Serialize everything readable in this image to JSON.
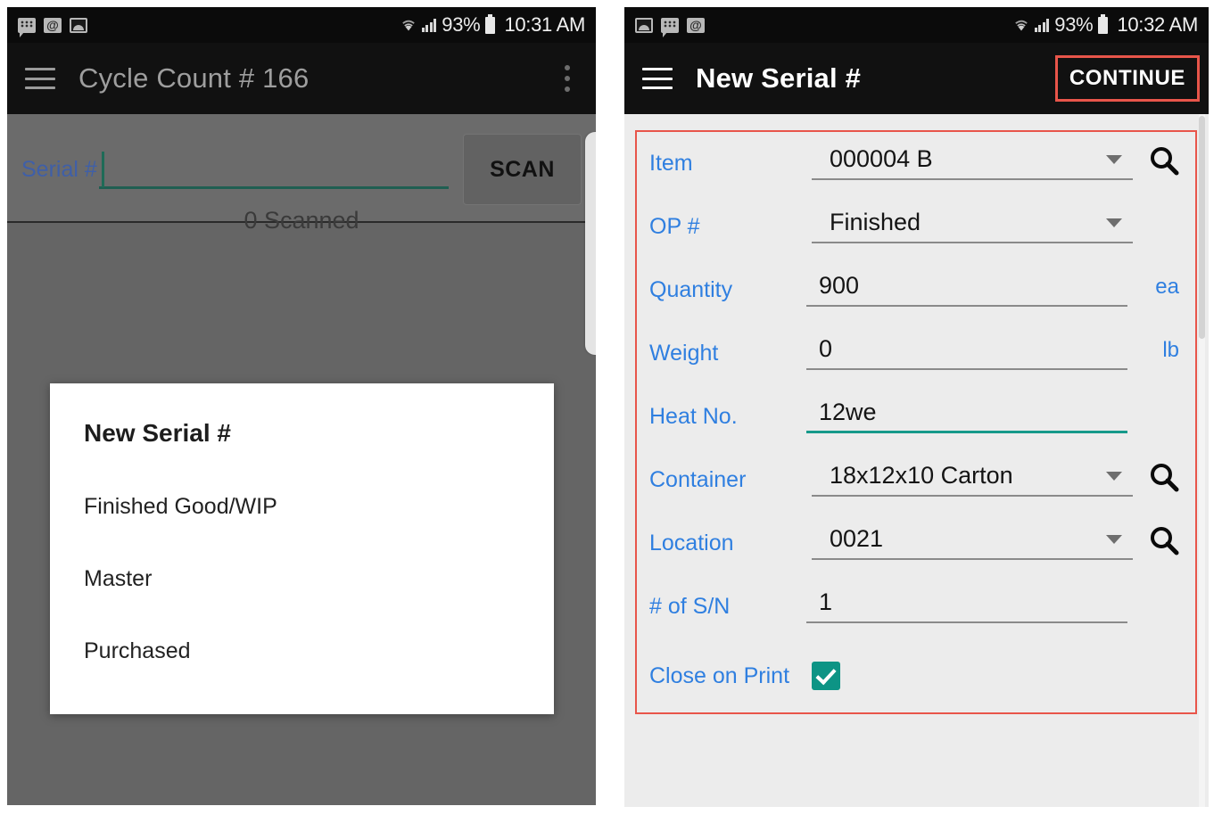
{
  "left_phone": {
    "statusbar": {
      "icons": [
        "chat-icon",
        "at-email-icon",
        "photo-icon"
      ],
      "wifi_icon": "wifi-icon",
      "signal_icon": "signal-bars-icon",
      "battery_pct": "93%",
      "battery_icon": "battery-icon",
      "time": "10:31 AM"
    },
    "appbar": {
      "menu_icon": "hamburger-menu-icon",
      "title": "Cycle Count # 166",
      "overflow_icon": "kebab-overflow-icon"
    },
    "scan": {
      "label": "Serial #",
      "value": "",
      "placeholder": "",
      "button_label": "SCAN",
      "count_text": "0 Scanned"
    },
    "dialog": {
      "title": "New Serial #",
      "options": [
        {
          "label": "Finished Good/WIP"
        },
        {
          "label": "Master"
        },
        {
          "label": "Purchased"
        }
      ]
    }
  },
  "right_phone": {
    "statusbar": {
      "icons": [
        "photo-icon",
        "chat-icon",
        "at-email-icon"
      ],
      "wifi_icon": "wifi-icon",
      "signal_icon": "signal-bars-icon",
      "battery_pct": "93%",
      "battery_icon": "battery-icon",
      "time": "10:32 AM"
    },
    "appbar": {
      "menu_icon": "hamburger-menu-icon",
      "title": "New Serial #",
      "continue_label": "CONTINUE"
    },
    "form": {
      "fields": [
        {
          "label": "Item",
          "value": "000004 B",
          "type": "dropdown-search",
          "unit": ""
        },
        {
          "label": "OP #",
          "value": "Finished",
          "type": "dropdown",
          "unit": ""
        },
        {
          "label": "Quantity",
          "value": "900",
          "type": "text",
          "unit": "ea"
        },
        {
          "label": "Weight",
          "value": "0",
          "type": "text",
          "unit": "lb"
        },
        {
          "label": "Heat No.",
          "value": "12we",
          "type": "text-focused",
          "unit": ""
        },
        {
          "label": "Container",
          "value": "18x12x10 Carton",
          "type": "dropdown-search",
          "unit": ""
        },
        {
          "label": "Location",
          "value": "0021",
          "type": "dropdown-search",
          "unit": ""
        },
        {
          "label": "# of S/N",
          "value": "1",
          "type": "text",
          "unit": ""
        }
      ],
      "checkbox_field": {
        "label": "Close on Print",
        "checked": true
      }
    }
  },
  "colors": {
    "accent_teal": "#0d9485",
    "label_blue": "#2f7fe0",
    "annotation_red": "#e8554a",
    "appbar_dark": "#111111",
    "statusbar_black": "#0b0b0b",
    "scrim_gray": "#656565",
    "form_bg": "#ececec"
  }
}
